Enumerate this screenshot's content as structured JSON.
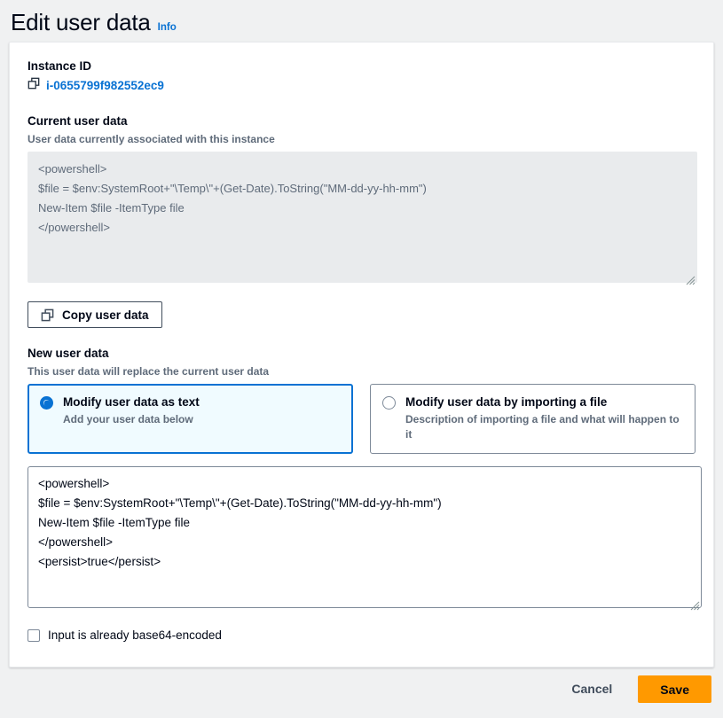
{
  "header": {
    "title": "Edit user data",
    "info_label": "Info"
  },
  "instance": {
    "label": "Instance ID",
    "id": "i-0655799f982552ec9",
    "copy_icon": "copy-icon"
  },
  "current_user_data": {
    "label": "Current user data",
    "description": "User data currently associated with this instance",
    "value": "<powershell>\n$file = $env:SystemRoot+\"\\Temp\\\"+(Get-Date).ToString(\"MM-dd-yy-hh-mm\")\nNew-Item $file -ItemType file\n</powershell>"
  },
  "copy_button": {
    "label": "Copy user data",
    "icon": "copy-icon"
  },
  "new_user_data": {
    "label": "New user data",
    "description": "This user data will replace the current user data",
    "value": "<powershell>\n$file = $env:SystemRoot+\"\\Temp\\\"+(Get-Date).ToString(\"MM-dd-yy-hh-mm\")\nNew-Item $file -ItemType file\n</powershell>\n<persist>true</persist>",
    "placeholder": "",
    "options": [
      {
        "title": "Modify user data as text",
        "description": "Add your user data below",
        "selected": true
      },
      {
        "title": "Modify user data by importing a file",
        "description": "Description of importing a file and what will happen to it",
        "selected": false
      }
    ]
  },
  "base64_checkbox": {
    "label": "Input is already base64-encoded",
    "checked": false
  },
  "footer": {
    "cancel_label": "Cancel",
    "save_label": "Save"
  },
  "colors": {
    "accent_blue": "#0972d3",
    "primary_orange": "#ff9900",
    "page_bg": "#f0f1f2",
    "readonly_bg": "#e9ebed",
    "selected_tile_bg": "#f0fbff"
  }
}
